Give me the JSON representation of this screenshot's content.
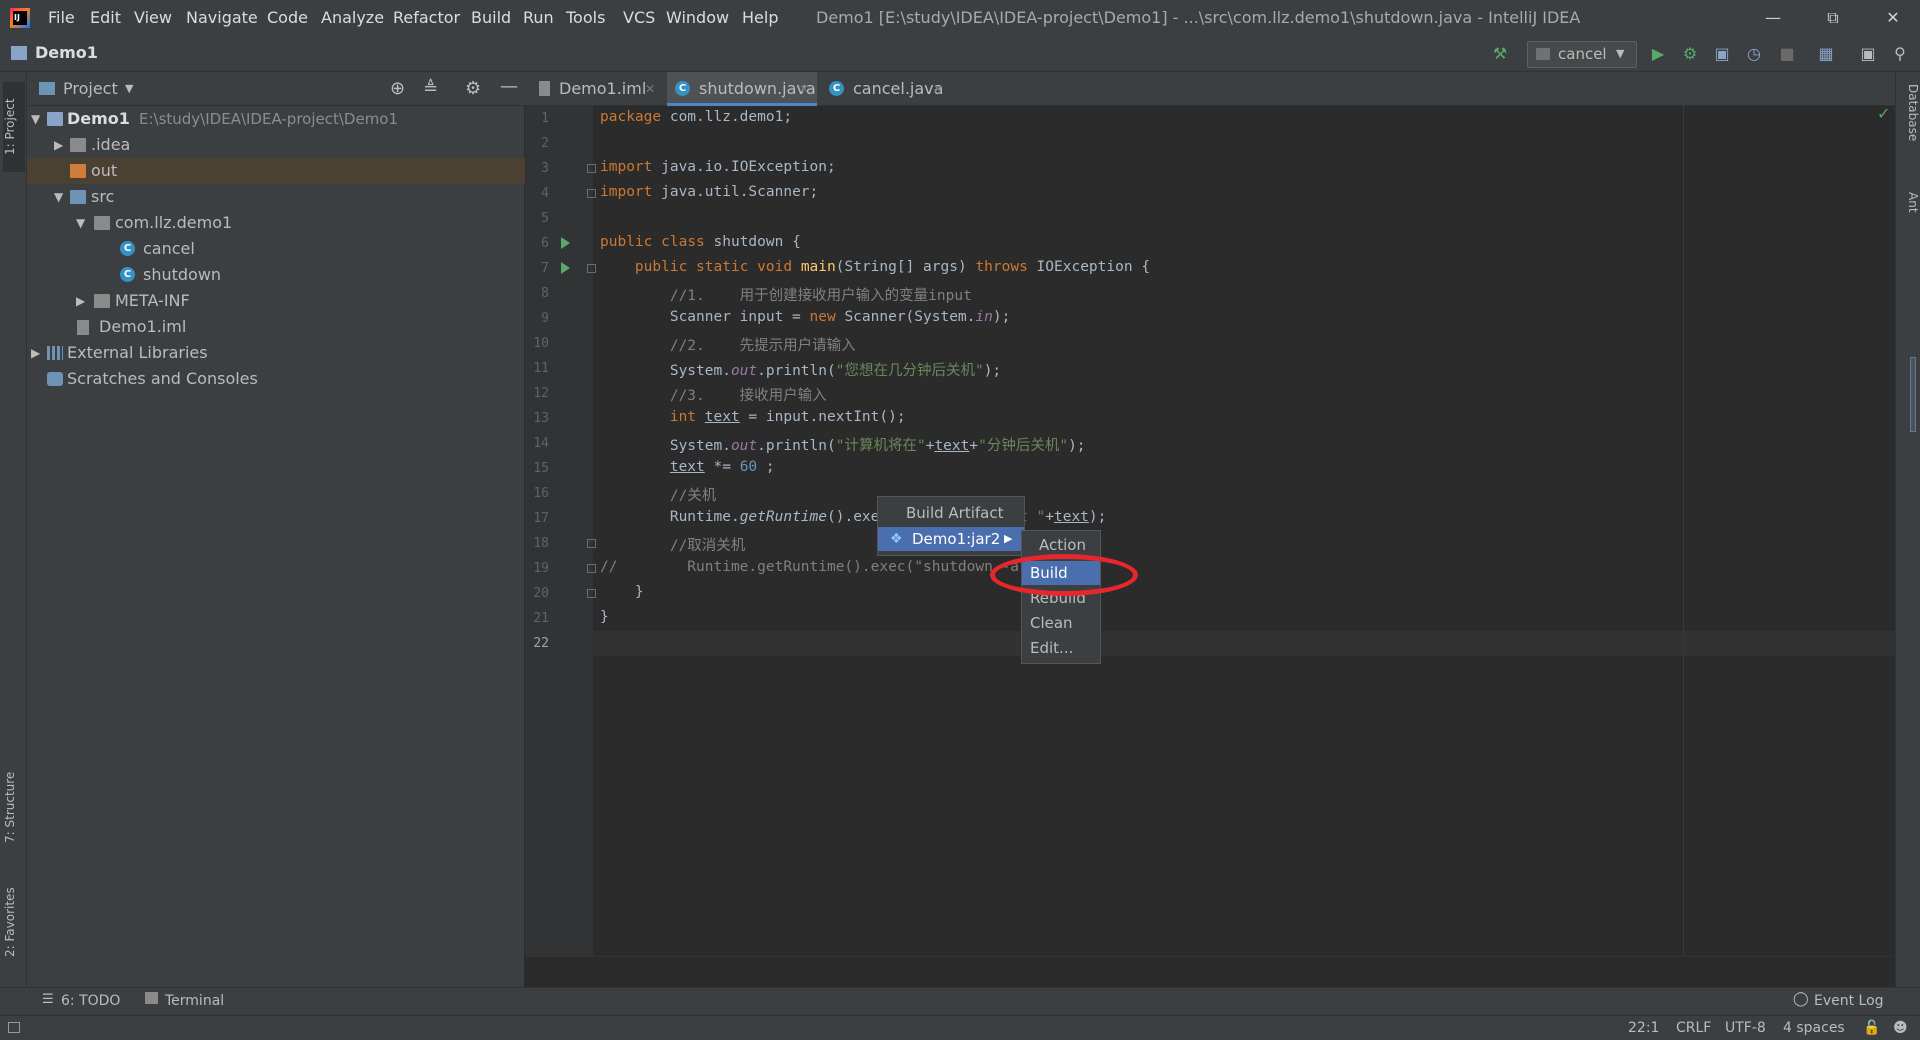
{
  "window": {
    "title": "Demo1 [E:\\study\\IDEA\\IDEA-project\\Demo1] - ...\\src\\com.llz.demo1\\shutdown.java - IntelliJ IDEA",
    "app_icon_text": "IJ"
  },
  "menu": [
    "File",
    "Edit",
    "View",
    "Navigate",
    "Code",
    "Analyze",
    "Refactor",
    "Build",
    "Run",
    "Tools",
    "VCS",
    "Window",
    "Help"
  ],
  "navbar": {
    "project": "Demo1",
    "run_config": "cancel"
  },
  "left_stripe": {
    "project": "1: Project",
    "structure": "7: Structure",
    "favorites": "2: Favorites"
  },
  "right_stripe": {
    "database": "Database",
    "ant": "Ant"
  },
  "project_panel": {
    "title": "Project",
    "root_name": "Demo1",
    "root_path": "E:\\study\\IDEA\\IDEA-project\\Demo1",
    "items": [
      ".idea",
      "out",
      "src",
      "com.llz.demo1",
      "cancel",
      "shutdown",
      "META-INF",
      "Demo1.iml",
      "External Libraries",
      "Scratches and Consoles"
    ]
  },
  "tabs": [
    "Demo1.iml",
    "shutdown.java",
    "cancel.java"
  ],
  "editor": {
    "line_numbers": [
      "1",
      "2",
      "3",
      "4",
      "5",
      "6",
      "7",
      "8",
      "9",
      "10",
      "11",
      "12",
      "13",
      "14",
      "15",
      "16",
      "17",
      "18",
      "19",
      "20",
      "21",
      "22"
    ],
    "code_lines": [
      "package com.llz.demo1;",
      "",
      "import java.io.IOException;",
      "import java.util.Scanner;",
      "",
      "public class shutdown {",
      "    public static void main(String[] args) throws IOException {",
      "        //1.    用于创建接收用户输入的变量input",
      "        Scanner input = new Scanner(System.in);",
      "        //2.    先提示用户请输入",
      "        System.out.println(\"您想在几分钟后关机\");",
      "        //3.    接收用户输入",
      "        int text = input.nextInt();",
      "        System.out.println(\"计算机将在\"+text+\"分钟后关机\");",
      "        text *= 60 ;",
      "        //关机",
      "        Runtime.getRuntime().exec(\"shutdown -s -t \"+text);",
      "        //取消关机",
      "//        Runtime.getRuntime().exec(\"shutdown -a\");",
      "    }",
      "}",
      ""
    ]
  },
  "popup_build_artifact": {
    "title": "Build Artifact",
    "artifact": "Demo1:jar2"
  },
  "popup_action": {
    "title": "Action",
    "items": [
      "Build",
      "Rebuild",
      "Clean",
      "Edit..."
    ],
    "selected": "Build"
  },
  "bottom_bar": {
    "todo": "6: TODO",
    "terminal": "Terminal",
    "event_log": "Event Log"
  },
  "status_bar": {
    "position": "22:1",
    "line_sep": "CRLF",
    "encoding": "UTF-8",
    "indent": "4 spaces"
  },
  "colors": {
    "selection": "#4b6eaf",
    "highlight_ellipse": "#e8262e",
    "keyword": "#cc7832",
    "string": "#6a8759"
  }
}
